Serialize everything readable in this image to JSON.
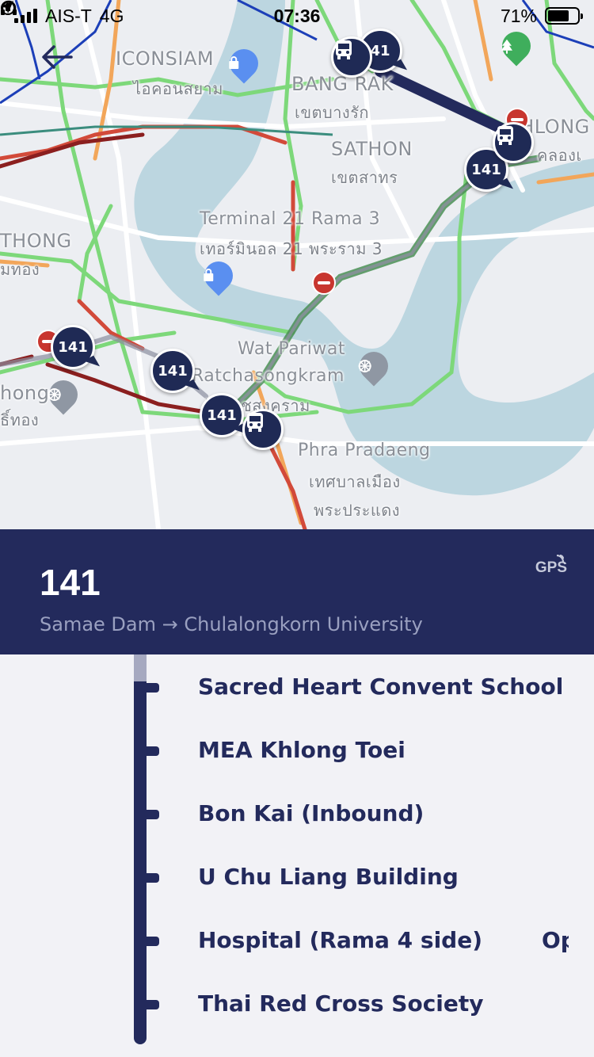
{
  "status_bar": {
    "carrier": "AIS-T",
    "network": "4G",
    "time": "07:36",
    "battery_percent": "71%",
    "battery_level": 0.71
  },
  "map": {
    "labels": {
      "iconsiam": "ICONSIAM",
      "iconsiam_th": "ไอคอนสยาม",
      "bang_rak": "BANG RAK",
      "bang_rak_th": "เขตบางรัก",
      "sathon": "SATHON",
      "sathon_th": "เขตสาทร",
      "khlong_toei": "KHLONG T",
      "khlong_toei_th": "คลองเ",
      "terminal21": "Terminal 21 Rama 3",
      "terminal21_th": "เทอร์มินอล 21 พระราม 3",
      "thonburi": "THONG",
      "thonburi_th": "มทอง",
      "wat_pariwat": "Wat Pariwat",
      "ratchasongkram": "Ratchasongkram",
      "ratchasongkram_th": "วัดราชสงคราม",
      "phra_pradaeng": "Phra Pradaeng",
      "phra_pradaeng_th1": "เทศบาลเมือง",
      "phra_pradaeng_th2": "พระประแดง",
      "hong": "hong",
      "hong_th": "ธิ์ทอง"
    },
    "bus_badges": [
      "41",
      "141",
      "141",
      "141",
      "141"
    ],
    "icons": {
      "shopping": "shopping-bag-icon",
      "temple": "dharma-wheel-icon",
      "park": "tree-icon",
      "bus": "bus-icon"
    },
    "colors": {
      "water": "#b9d3dd",
      "traffic_fast": "#7dd87a",
      "traffic_medium": "#f2a65a",
      "traffic_slow": "#d24a3a",
      "traffic_jam": "#8b1f1f",
      "route": "#232a5c"
    }
  },
  "route": {
    "number": "141",
    "direction": "Samae Dam → Chulalongkorn University",
    "gps_label": "GPS"
  },
  "stops": [
    {
      "name": "Sacred Heart Convent School"
    },
    {
      "name": "MEA Khlong Toei"
    },
    {
      "name": "Bon Kai (Inbound)"
    },
    {
      "name": "U Chu Liang Building"
    },
    {
      "name": "Hospital (Rama 4 side)",
      "extra": "Op"
    },
    {
      "name": "Thai Red Cross Society"
    }
  ]
}
